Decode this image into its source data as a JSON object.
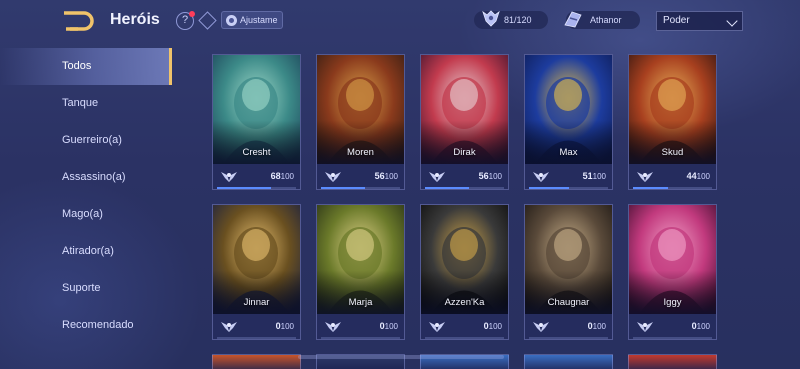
{
  "header": {
    "title": "Heróis",
    "adjust_label": "Ajustame",
    "hero_count": "81/120",
    "server_name": "Athanor",
    "sort_selected": "Poder"
  },
  "sidebar": {
    "items": [
      {
        "label": "Todos",
        "active": true
      },
      {
        "label": "Tanque"
      },
      {
        "label": "Guerreiro(a)"
      },
      {
        "label": "Assassino(a)"
      },
      {
        "label": "Mago(a)"
      },
      {
        "label": "Atirador(a)"
      },
      {
        "label": "Suporte"
      },
      {
        "label": "Recomendado"
      }
    ]
  },
  "heroes": [
    {
      "name": "Cresht",
      "points": "68",
      "max": "100",
      "progress": 0.68,
      "colors": [
        "#3c8a88",
        "#9fd9c9",
        "#1f4a5e"
      ]
    },
    {
      "name": "Moren",
      "points": "56",
      "max": "100",
      "progress": 0.56,
      "colors": [
        "#8a3a1c",
        "#d9a04a",
        "#3a1f14"
      ]
    },
    {
      "name": "Dirak",
      "points": "56",
      "max": "100",
      "progress": 0.56,
      "colors": [
        "#c23b4e",
        "#e8d0d4",
        "#4a1730"
      ]
    },
    {
      "name": "Max",
      "points": "51",
      "max": "100",
      "progress": 0.51,
      "colors": [
        "#1d3c9e",
        "#e6c04a",
        "#0f1f5c"
      ]
    },
    {
      "name": "Skud",
      "points": "44",
      "max": "100",
      "progress": 0.44,
      "colors": [
        "#a8401f",
        "#e8b15a",
        "#3d1a12"
      ]
    },
    {
      "name": "Jinnar",
      "points": "0",
      "max": "100",
      "progress": 0,
      "colors": [
        "#6a5020",
        "#e8c070",
        "#20243e"
      ]
    },
    {
      "name": "Marja",
      "points": "0",
      "max": "100",
      "progress": 0,
      "colors": [
        "#6b7a2a",
        "#e0d28a",
        "#2c3518"
      ]
    },
    {
      "name": "Azzen'Ka",
      "points": "0",
      "max": "100",
      "progress": 0,
      "colors": [
        "#3a3a3a",
        "#d0a64a",
        "#101010"
      ]
    },
    {
      "name": "Chaugnar",
      "points": "0",
      "max": "100",
      "progress": 0,
      "colors": [
        "#5a4a3a",
        "#c9b08a",
        "#201a16"
      ]
    },
    {
      "name": "Iggy",
      "points": "0",
      "max": "100",
      "progress": 0,
      "colors": [
        "#c23a7e",
        "#f3a3c9",
        "#4a1236"
      ]
    }
  ],
  "partial_row_colors": [
    "#c8542a",
    "#2e3a6a",
    "#3a6ec2",
    "#3a6ec2",
    "#c23a2e"
  ]
}
